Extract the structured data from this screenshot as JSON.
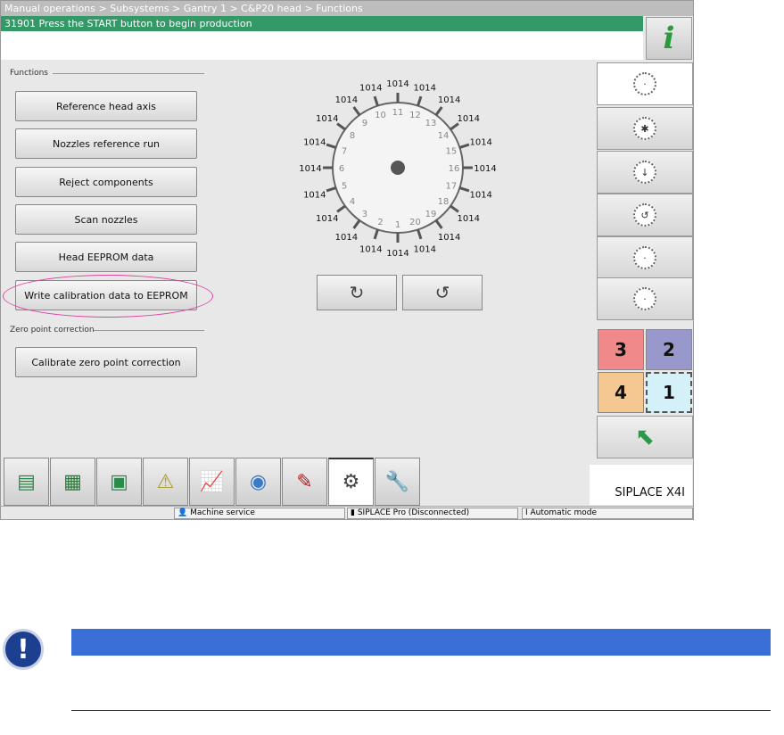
{
  "breadcrumb": "Manual operations > Subsystems > Gantry 1 > C&P20 head > Functions",
  "message": "31901 Press the START button to begin production",
  "info_icon": "i",
  "functions": {
    "title": "Functions",
    "buttons": [
      "Reference head axis",
      "Nozzles reference run",
      "Reject components",
      "Scan nozzles",
      "Head EEPROM data",
      "Write calibration data to EEPROM"
    ]
  },
  "zero": {
    "title": "Zero point correction",
    "button": "Calibrate zero point correction"
  },
  "dial": {
    "positions": [
      1,
      2,
      3,
      4,
      5,
      6,
      7,
      8,
      9,
      10,
      11,
      12,
      13,
      14,
      15,
      16,
      17,
      18,
      19,
      20
    ],
    "values": [
      "1014",
      "1014",
      "1014",
      "1014",
      "1014",
      "1014",
      "1014",
      "1014",
      "1014",
      "1014",
      "1014",
      "1014",
      "1014",
      "1014",
      "1014",
      "1014",
      "1014",
      "1014",
      "1014",
      "1014"
    ]
  },
  "rotate": {
    "ccw": "↻",
    "cw": "↺"
  },
  "gantries": [
    {
      "label": "3",
      "color": "#f08a8a"
    },
    {
      "label": "2",
      "color": "#9898cc"
    },
    {
      "label": "4",
      "color": "#f4c890"
    },
    {
      "label": "1",
      "color": "#d4f0f8"
    }
  ],
  "brand": "SIPLACE X4I",
  "status": {
    "user": "Machine service",
    "pro": "SIPLACE Pro (Disconnected)",
    "mode": "Automatic mode"
  },
  "tabs": [
    "pcb-stack-icon",
    "feeder-grid-icon",
    "board-icon",
    "alarm-icon",
    "statistics-icon",
    "camera-icon",
    "tool-icon",
    "service-icon",
    "wrench-icon"
  ]
}
